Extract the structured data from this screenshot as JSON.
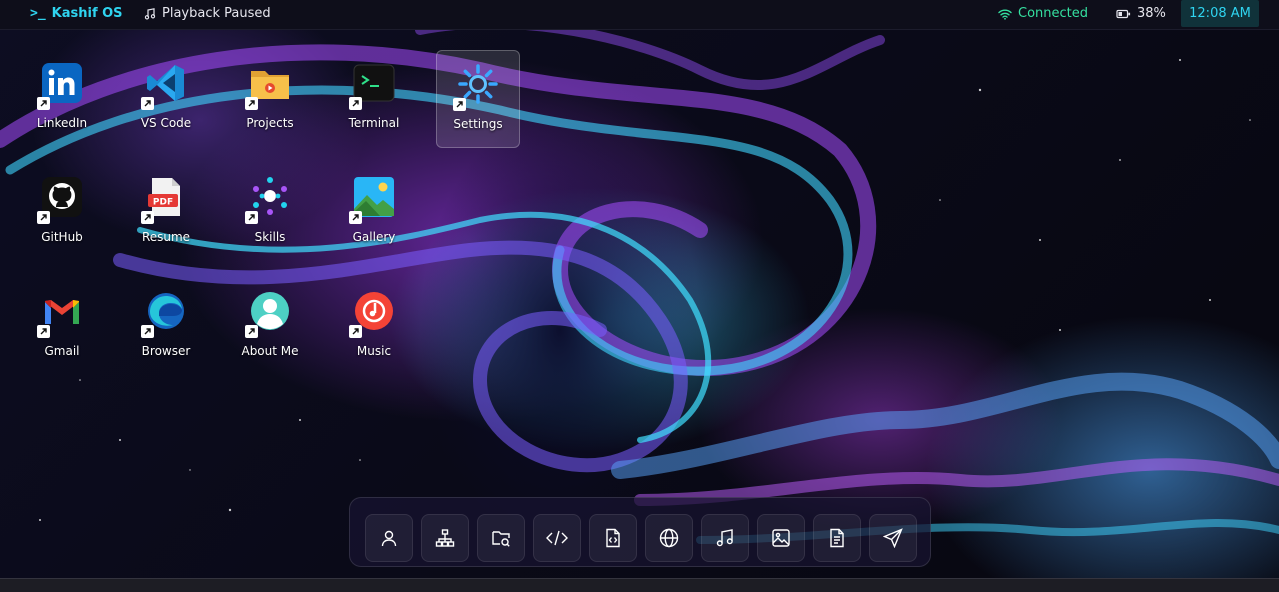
{
  "topbar": {
    "brand": "Kashif OS",
    "playback": "Playback Paused",
    "connection": "Connected",
    "battery": "38%",
    "time": "12:08 AM"
  },
  "desktop": {
    "linkedin": "LinkedIn",
    "vscode": "VS Code",
    "projects": "Projects",
    "terminal": "Terminal",
    "settings": "Settings",
    "github": "GitHub",
    "resume": "Resume",
    "skills": "Skills",
    "gallery": "Gallery",
    "gmail": "Gmail",
    "browser": "Browser",
    "about": "About Me",
    "music": "Music"
  },
  "dock": [
    "user-icon",
    "sitemap-icon",
    "folder-search-icon",
    "code-icon",
    "code-file-icon",
    "globe-icon",
    "music-icon",
    "image-icon",
    "document-icon",
    "send-icon"
  ],
  "colors": {
    "accent": "#2fd4f0",
    "connected": "#35e0a0",
    "clock_bg": "#10323a"
  }
}
